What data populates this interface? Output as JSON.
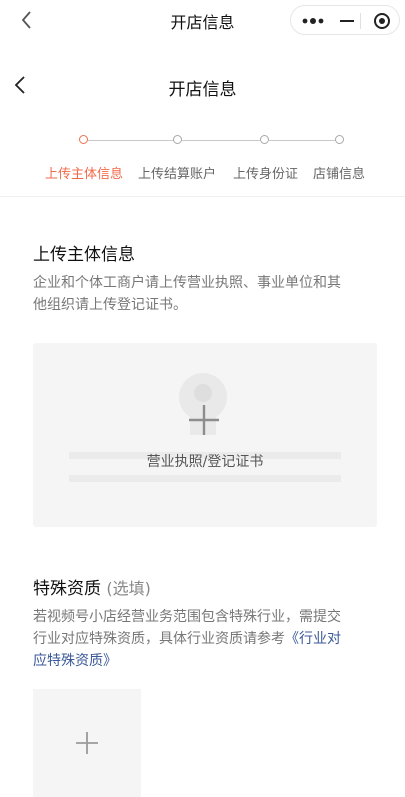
{
  "topbar": {
    "title": "开店信息"
  },
  "page": {
    "title": "开店信息"
  },
  "steps": [
    {
      "label": "上传主体信息",
      "active": true
    },
    {
      "label": "上传结算账户",
      "active": false
    },
    {
      "label": "上传身份证",
      "active": false
    },
    {
      "label": "店铺信息",
      "active": false
    }
  ],
  "subject": {
    "title": "上传主体信息",
    "desc_line1": "企业和个体工商户请上传营业执照、事业单位和其",
    "desc_line2": "他组织请上传登记证书。",
    "upload_label": "营业执照/登记证书"
  },
  "special": {
    "title": "特殊资质",
    "optional": "(选填)",
    "desc_line1": "若视频号小店经营业务范围包含特殊行业，需提交",
    "desc_line2_prefix": "行业对应特殊资质，具体行业资质请参考",
    "link_part1": "《行业对",
    "link_part2": "应特殊资质》"
  },
  "colors": {
    "accent": "#f06a4a",
    "link": "#3b5998"
  }
}
